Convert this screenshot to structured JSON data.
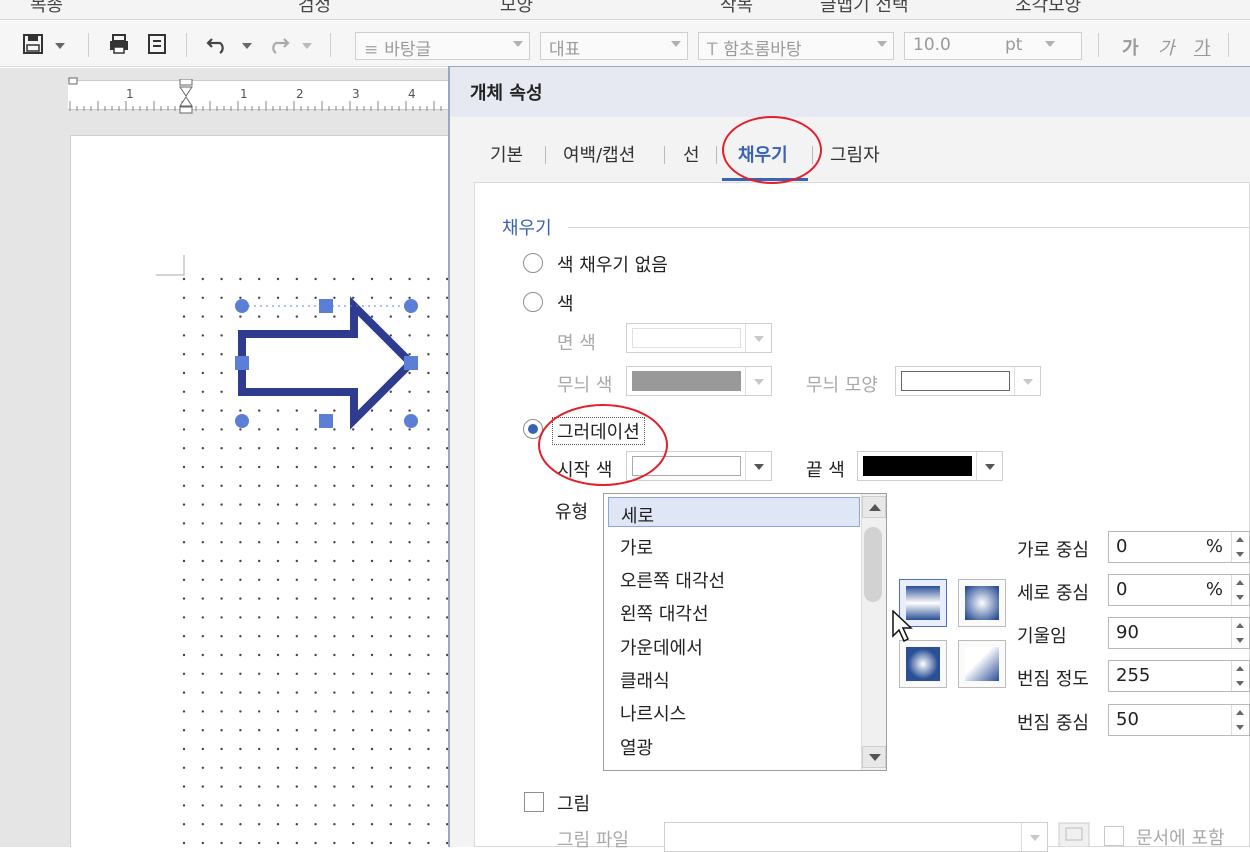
{
  "topstrip": {
    "items": [
      "목종",
      "검정",
      "모양",
      "작목",
      "글맵기 선택",
      "조각모양"
    ]
  },
  "toolbar": {
    "style_combo": "바탕글",
    "para_combo": "대표",
    "font_combo": "함초롬바탕",
    "size_value": "10.0",
    "size_unit": "pt",
    "bold_label": "가",
    "italic_label": "가",
    "underline_label": "가"
  },
  "ruler": {
    "marks": [
      "1",
      "1",
      "2",
      "3",
      "4"
    ]
  },
  "dialog": {
    "title": "개체 속성",
    "tabs": [
      "기본",
      "여백/캡션",
      "선",
      "채우기",
      "그림자"
    ],
    "active_tab": "채우기"
  },
  "fill": {
    "section_title": "채우기",
    "option_none": "색 채우기 없음",
    "option_color": "색",
    "face_color_label": "면 색",
    "pattern_color_label": "무늬 색",
    "pattern_shape_label": "무늬 모양",
    "option_gradient": "그러데이션",
    "start_color_label": "시작 색",
    "end_color_label": "끝 색",
    "type_label": "유형",
    "types": [
      "세로",
      "가로",
      "오른쪽 대각선",
      "왼쪽 대각선",
      "가운데에서",
      "클래식",
      "나르시스",
      "열광"
    ],
    "selected_type": "세로",
    "h_center_label": "가로 중심",
    "h_center_value": "0",
    "v_center_label": "세로 중심",
    "v_center_value": "0",
    "percent_unit": "%",
    "tilt_label": "기울임",
    "tilt_value": "90",
    "spread_label": "번짐 정도",
    "spread_value": "255",
    "spread_center_label": "번짐 중심",
    "spread_center_value": "50",
    "picture_label": "그림",
    "picture_file_label": "그림 파일",
    "include_in_doc_label": "문서에 포함"
  },
  "colors": {
    "accent": "#3a62b5",
    "arrow": "#2e3b8f",
    "handle": "#5b7fd6",
    "annotation": "#e3202a",
    "end_color": "#000000",
    "pattern_color": "#999999"
  }
}
